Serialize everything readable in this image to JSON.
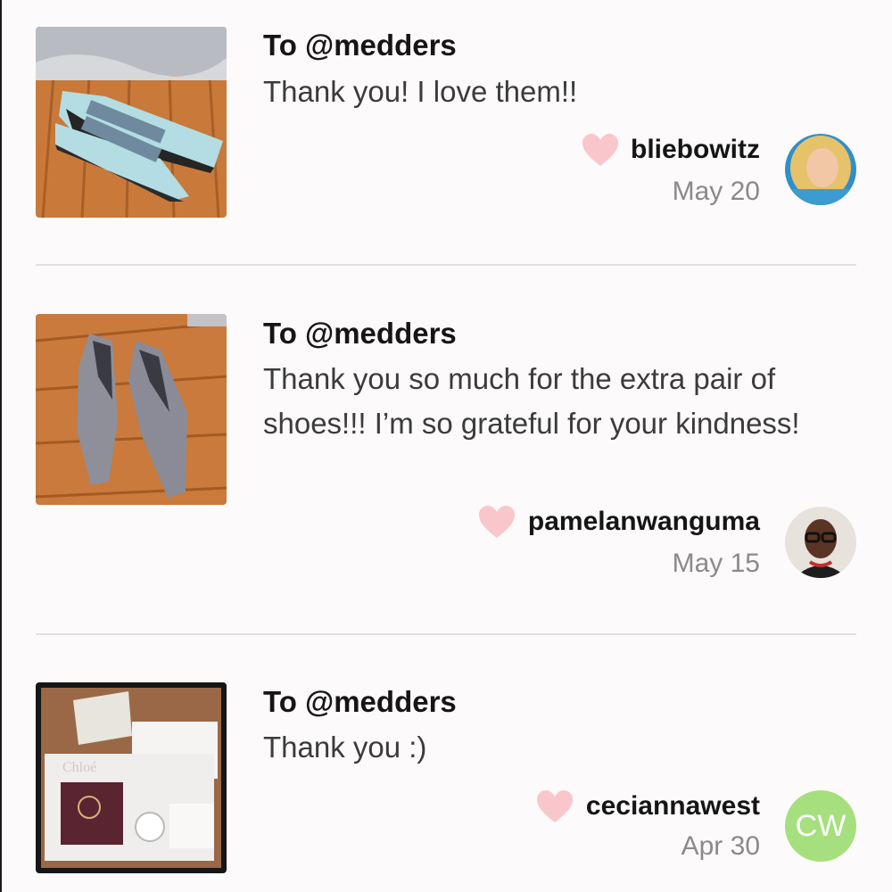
{
  "notes": [
    {
      "to": "To @medders",
      "message": "Thank you! I love them!!",
      "username": "bliebowitz",
      "date": "May 20",
      "photo_icon": "light-blue-loafers-photo",
      "avatar_icon": "blonde-user-avatar"
    },
    {
      "to": "To @medders",
      "message": "Thank you so much for the extra pair of shoes!!! I’m so grateful for your kindness!",
      "username": "pamelanwanguma",
      "date": "May 15",
      "photo_icon": "gray-suede-flats-photo",
      "avatar_icon": "user-with-glasses-avatar"
    },
    {
      "to": "To @medders",
      "message": "Thank you :)",
      "username": "ceciannawest",
      "date": "Apr 30",
      "photo_icon": "chloe-wallet-box-photo",
      "avatar_initials": "CW"
    }
  ],
  "photo_brand_text": "Chloé",
  "colors": {
    "heart": "#f9c6cc",
    "avatar_initials_bg": "#a6df7e",
    "divider": "#e4e0e0",
    "date_text": "#8a8a8a"
  }
}
